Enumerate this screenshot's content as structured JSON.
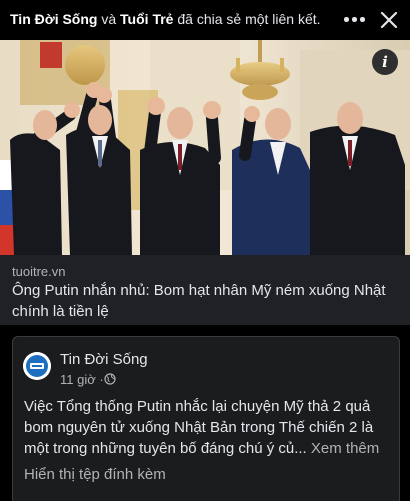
{
  "share_header": {
    "actor": "Tin Đời Sống",
    "connector": "và",
    "second_actor": "Tuổi Trẻ",
    "action": "đã chia sẻ một liên kết."
  },
  "link_preview": {
    "domain": "tuoitre.vn",
    "title": "Ông Putin nhắn nhủ: Bom hạt nhân Mỹ ném xuống Nhật chính là tiền lệ"
  },
  "shared_post": {
    "page_name": "Tin Đời Sống",
    "time": "11 giờ",
    "separator": "·",
    "text": "Việc Tổng thống Putin nhắc lại chuyện Mỹ thả 2 quả bom nguyên tử xuống Nhật Bản trong Thế chiến 2 là một trong những tuyên bố đáng chú ý củ...",
    "see_more": "Xem thêm",
    "attachment_label": "Hiển thị tệp đính kèm",
    "avatar_text": "TIN ĐỜI SỐNG"
  },
  "icons": {
    "more": "more-horizontal-icon",
    "close": "close-icon",
    "info": "info-icon",
    "audience": "globe-icon"
  },
  "colors": {
    "background": "#000000",
    "card": "#202124",
    "text_primary": "#e4e6eb",
    "text_secondary": "#b0b3b8",
    "avatar_blue": "#1f6fc0"
  }
}
